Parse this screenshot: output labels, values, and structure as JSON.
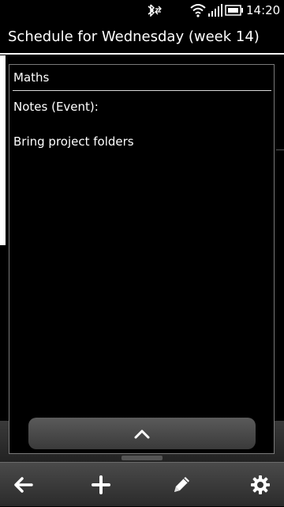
{
  "status_bar": {
    "time": "14:20",
    "icons": [
      "bluetooth-icon",
      "wifi-icon",
      "signal-icon",
      "battery-icon"
    ]
  },
  "header": {
    "title": "Schedule for Wednesday (week 14)"
  },
  "popup": {
    "event_title": "Maths",
    "notes_label": "Notes (Event):",
    "notes_text": "Bring project folders",
    "collapse_icon": "chevron-up-icon"
  },
  "toolbar": {
    "items": [
      {
        "icon": "back-arrow-icon"
      },
      {
        "icon": "plus-icon"
      },
      {
        "icon": "pencil-icon"
      },
      {
        "icon": "gear-icon"
      }
    ]
  },
  "colors": {
    "background": "#000000",
    "text": "#ffffff",
    "popup_border": "#7a7a7a",
    "toolbar": "#3a3a3a"
  }
}
